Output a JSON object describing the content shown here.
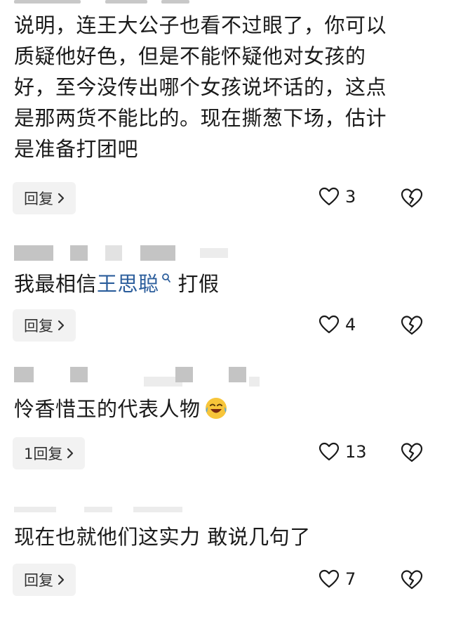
{
  "comments": [
    {
      "text_lines": [
        "说明，连王大公子也看不过眼了，你可以",
        "质疑他好色，但是不能怀疑他对女孩的",
        "好，至今没传出哪个女孩说坏话的，这点",
        "是那两货不能比的。现在撕葱下场，估计",
        "是准备打团吧"
      ],
      "reply_label": "回复",
      "likes": "3"
    },
    {
      "text_before": "我最相信",
      "mention": "王思聪",
      "text_after": "打假",
      "reply_label": "回复",
      "likes": "4"
    },
    {
      "text": "怜香惜玉的代表人物",
      "emoji": "laughing-crying-emoji",
      "reply_label": "1回复",
      "likes": "13"
    },
    {
      "text": "现在也就他们这实力 敢说几句了",
      "reply_label": "回复",
      "likes": "7"
    }
  ],
  "colors": {
    "mention": "#2c5e9c",
    "reply_bg": "#f2f2f2",
    "text": "#1a1a1a"
  },
  "icons": {
    "like": "heart-outline-icon",
    "dislike": "broken-heart-icon",
    "reply_arrow": "chevron-right-icon",
    "search": "search-icon"
  }
}
